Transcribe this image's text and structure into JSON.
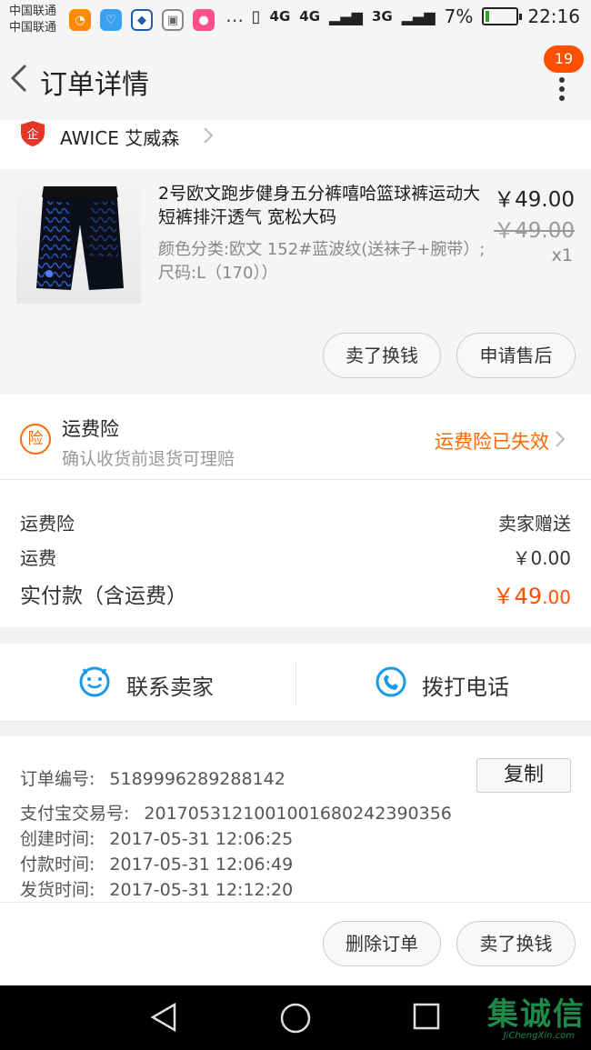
{
  "status_bar": {
    "carrier_1": "中国联通",
    "carrier_2": "中国联通",
    "network_a": "4G",
    "network_b": "4G",
    "network_c": "3G",
    "battery": "7%",
    "time": "22:16",
    "icons": [
      "uc-browser-icon",
      "health-icon",
      "diamond-icon",
      "gallery-icon",
      "chat-icon",
      "more-dots-icon"
    ]
  },
  "header": {
    "title": "订单详情",
    "badge_count": "19"
  },
  "shop": {
    "name": "AWICE 艾威森",
    "icon": "enterprise-shield-icon"
  },
  "product": {
    "title": "2号欧文跑步健身五分裤嘻哈篮球裤运动大短裤排汗透气 宽松大码",
    "sku": "颜色分类:欧文 152#蓝波纹(送袜子+腕带）;尺码:L（170））",
    "price": "￥49.00",
    "original_price": "￥49.00",
    "quantity": "x1",
    "buttons": {
      "resell": "卖了换钱",
      "after_sale": "申请售后"
    }
  },
  "insurance": {
    "icon_text": "险",
    "title": "运费险",
    "subtitle": "确认收货前退货可理赔",
    "status": "运费险已失效"
  },
  "fees": {
    "insurance_label": "运费险",
    "insurance_value": "卖家赠送",
    "shipping_label": "运费",
    "shipping_value": "￥0.00",
    "total_label": "实付款（含运费）",
    "total_main": "￥49",
    "total_decimal": ".00"
  },
  "contact": {
    "seller": "联系卖家",
    "phone": "拨打电话"
  },
  "order_info": {
    "order_no_label": "订单编号:",
    "order_no": "5189996289288142",
    "copy": "复制",
    "alipay_label": "支付宝交易号:",
    "alipay_no": "2017053121001001680242390356",
    "created_label": "创建时间:",
    "created": "2017-05-31 12:06:25",
    "paid_label": "付款时间:",
    "paid": "2017-05-31 12:06:49",
    "shipped_label": "发货时间:",
    "shipped": "2017-05-31 12:12:20"
  },
  "actions": {
    "delete": "删除订单",
    "resell": "卖了换钱"
  },
  "watermark": {
    "text": "集诚信",
    "sub": "JiChengXin.com"
  },
  "colors": {
    "accent": "#ff5000",
    "insurance_orange": "#ff6a00",
    "contact_blue": "#1a9be8"
  }
}
